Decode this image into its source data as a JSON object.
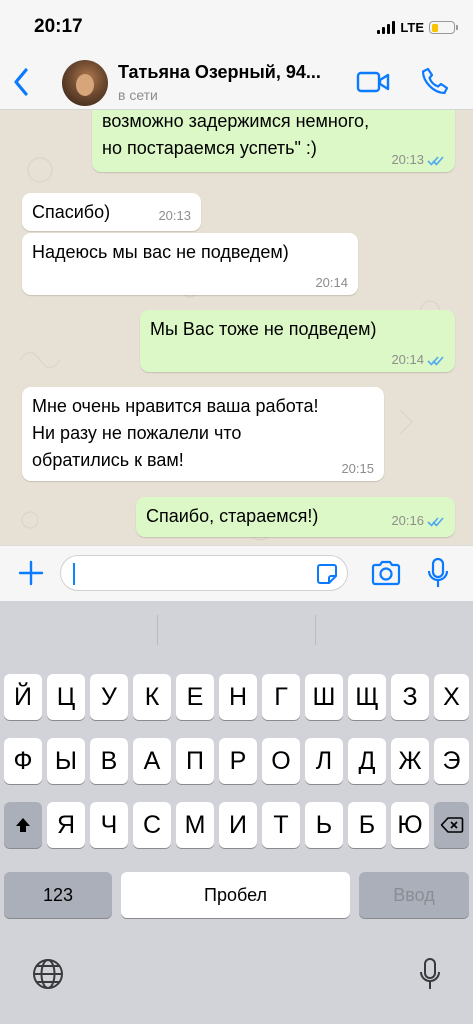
{
  "status_bar": {
    "time": "20:17",
    "network": "LTE",
    "battery_color": "#f6c500"
  },
  "header": {
    "back_icon": "chevron-left-icon",
    "contact_name": "Татьяна Озерный, 94...",
    "contact_status": "в сети",
    "video_icon": "video-camera-icon",
    "call_icon": "phone-icon",
    "accent_color": "#0a7aff"
  },
  "messages": [
    {
      "direction": "out",
      "lines": [
        "возможно задержимся немного,",
        "но постараемся успеть\" :)"
      ],
      "time": "20:13",
      "read": true
    },
    {
      "direction": "in",
      "lines": [
        "Спасибо)"
      ],
      "time": "20:13"
    },
    {
      "direction": "in",
      "lines": [
        "Надеюсь мы вас не подведем)"
      ],
      "time": "20:14"
    },
    {
      "direction": "out",
      "lines": [
        "Мы Вас тоже не подведем)"
      ],
      "time": "20:14",
      "read": true
    },
    {
      "direction": "in",
      "lines": [
        "Мне очень нравится ваша работа!",
        "Ни разу не пожалели что",
        "обратились к вам!"
      ],
      "time": "20:15"
    },
    {
      "direction": "out",
      "lines": [
        "Спаибо, стараемся!)"
      ],
      "time": "20:16",
      "read": true
    }
  ],
  "input_bar": {
    "plus_icon": "plus-icon",
    "input_value": "",
    "sticker_icon": "sticker-icon",
    "camera_icon": "camera-icon",
    "mic_icon": "microphone-icon"
  },
  "keyboard": {
    "row1": [
      "Й",
      "Ц",
      "У",
      "К",
      "Е",
      "Н",
      "Г",
      "Ш",
      "Щ",
      "З",
      "Х"
    ],
    "row2": [
      "Ф",
      "Ы",
      "В",
      "А",
      "П",
      "Р",
      "О",
      "Л",
      "Д",
      "Ж",
      "Э"
    ],
    "row3": [
      "Я",
      "Ч",
      "С",
      "М",
      "И",
      "Т",
      "Ь",
      "Б",
      "Ю"
    ],
    "shift_icon": "shift-icon",
    "delete_icon": "backspace-icon",
    "numbers_label": "123",
    "space_label": "Пробел",
    "return_label": "Ввод",
    "globe_icon": "globe-icon",
    "dictation_icon": "microphone-icon"
  }
}
